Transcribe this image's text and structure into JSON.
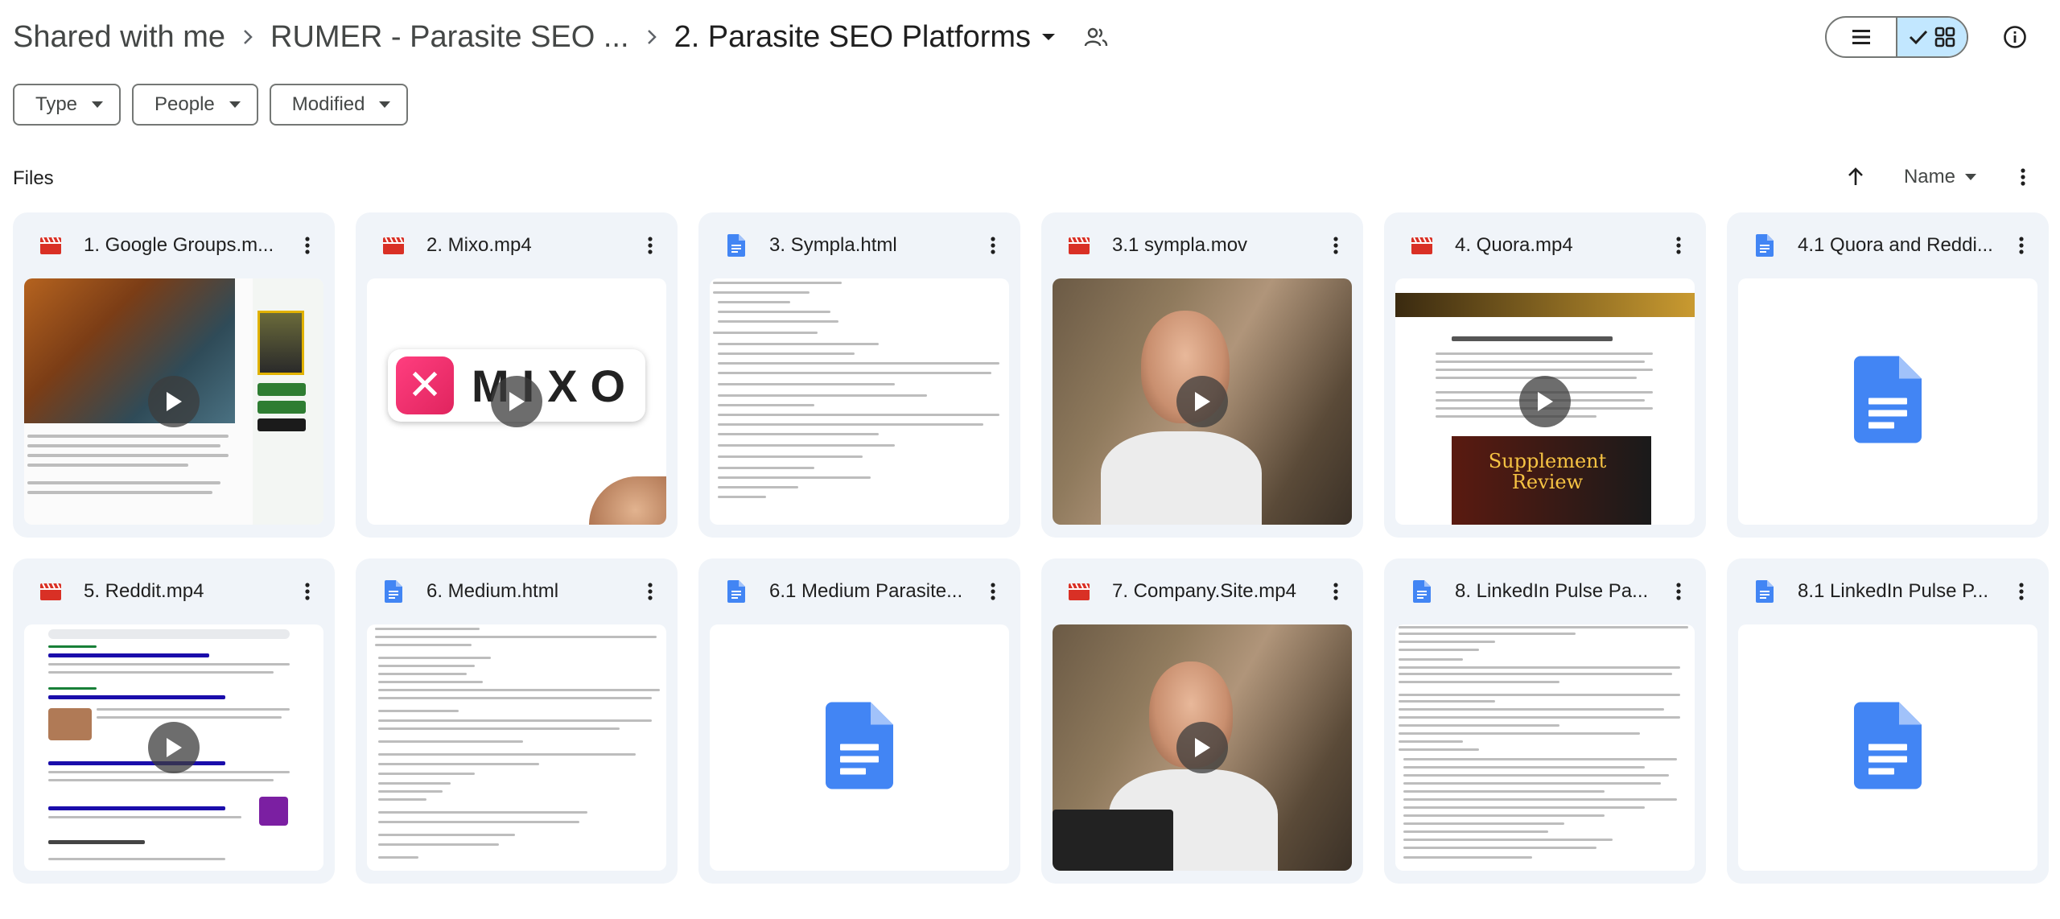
{
  "breadcrumb": {
    "items": [
      "Shared with me",
      "RUMER - Parasite SEO ...",
      "2. Parasite SEO Platforms"
    ]
  },
  "filters": [
    "Type",
    "People",
    "Modified"
  ],
  "files_section": {
    "label": "Files",
    "sort_label": "Name"
  },
  "colors": {
    "accent": "#c2e7ff",
    "video_icon": "#d93025",
    "doc_icon": "#4285f4",
    "card_bg": "#f0f4f9"
  },
  "files": [
    {
      "name": "1. Google Groups.m...",
      "type": "video"
    },
    {
      "name": "2. Mixo.mp4",
      "type": "video"
    },
    {
      "name": "3. Sympla.html",
      "type": "doc"
    },
    {
      "name": "3.1 sympla.mov",
      "type": "video"
    },
    {
      "name": "4. Quora.mp4",
      "type": "video"
    },
    {
      "name": "4.1 Quora and Reddi...",
      "type": "doc"
    },
    {
      "name": "5. Reddit.mp4",
      "type": "video"
    },
    {
      "name": "6. Medium.html",
      "type": "doc"
    },
    {
      "name": "6.1 Medium Parasite...",
      "type": "doc"
    },
    {
      "name": "7. Company.Site.mp4",
      "type": "video"
    },
    {
      "name": "8. LinkedIn Pulse Pa...",
      "type": "doc"
    },
    {
      "name": "8.1 LinkedIn Pulse P...",
      "type": "doc"
    }
  ],
  "thumb_text": {
    "mixo": "MIXO",
    "supplement": "Supplement Review"
  }
}
